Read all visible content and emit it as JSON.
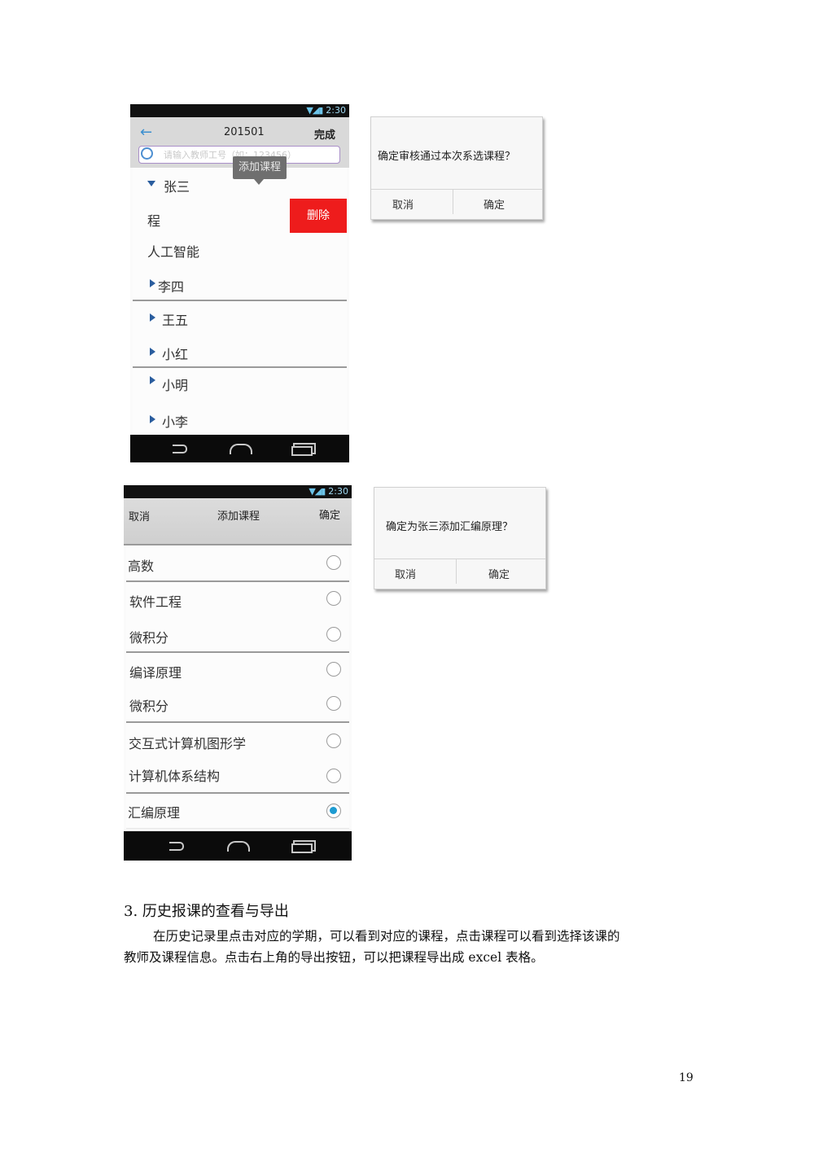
{
  "phone1": {
    "time": "2:30",
    "title": "201501",
    "done": "完成",
    "search_placeholder": "请输入教师工号（如：123456）",
    "tooltip": "添加课程",
    "rows": {
      "zhangsan": "张三",
      "course_partial": "程",
      "delete": "删除",
      "ai": "人工智能",
      "lisi": "李四",
      "wangwu": "王五",
      "xiaohong": "小红",
      "xiaoming": "小明",
      "xiaoli": "小李"
    }
  },
  "dialog1": {
    "message": "确定审核通过本次系选课程？",
    "cancel": "取消",
    "confirm": "确定"
  },
  "phone2": {
    "time": "2:30",
    "cancel": "取消",
    "title": "添加课程",
    "confirm": "确定",
    "courses": [
      {
        "name": "高数",
        "selected": false
      },
      {
        "name": "软件工程",
        "selected": false
      },
      {
        "name": "微积分",
        "selected": false
      },
      {
        "name": "编译原理",
        "selected": false
      },
      {
        "name": "微积分",
        "selected": false
      },
      {
        "name": "交互式计算机图形学",
        "selected": false
      },
      {
        "name": "计算机体系结构",
        "selected": false
      },
      {
        "name": "汇编原理",
        "selected": true
      }
    ]
  },
  "dialog2": {
    "message": "确定为张三添加汇编原理？",
    "cancel": "取消",
    "confirm": "确定"
  },
  "section": {
    "heading": "3. 历史报课的查看与导出",
    "para_line1": "在历史记录里点击对应的学期，可以看到对应的课程，点击课程可以看到选择该课的",
    "para_line2": "教师及课程信息。点击右上角的导出按钮，可以把课程导出成 excel 表格。"
  },
  "page_number": "19",
  "colors": {
    "delete_red": "#ee1c1c",
    "radio_blue": "#1d9bd1",
    "tree_arrow": "#2a5d9e"
  }
}
